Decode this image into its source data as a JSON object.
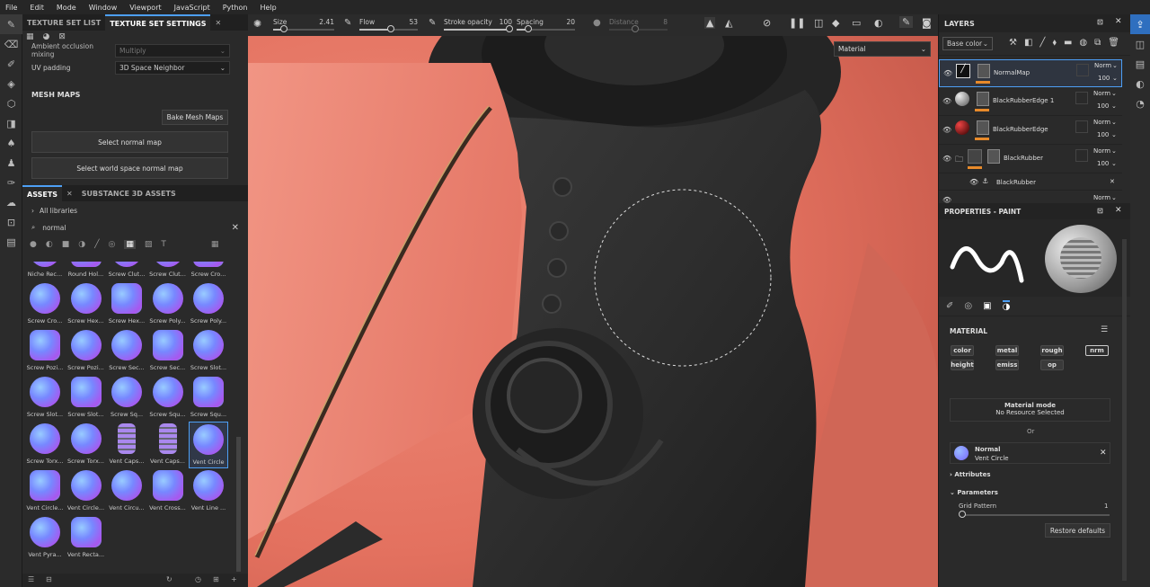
{
  "menu": [
    "File",
    "Edit",
    "Mode",
    "Window",
    "Viewport",
    "JavaScript",
    "Python",
    "Help"
  ],
  "left_panel": {
    "tabs": [
      "TEXTURE SET LIST",
      "TEXTURE SET SETTINGS"
    ],
    "ao_mixing_label": "Ambient occlusion mixing",
    "ao_mixing_value": "Multiply",
    "uv_padding_label": "UV padding",
    "uv_padding_value": "3D Space Neighbor",
    "mesh_maps_title": "MESH MAPS",
    "bake_button": "Bake Mesh Maps",
    "select_normal": "Select normal map",
    "select_world": "Select world space normal map"
  },
  "assets": {
    "tabs": [
      "ASSETS",
      "SUBSTANCE 3D ASSETS"
    ],
    "all_libraries": "All libraries",
    "search_value": "normal",
    "items": [
      {
        "label": "Niche Rec..."
      },
      {
        "label": "Round Hol..."
      },
      {
        "label": "Screw Clut..."
      },
      {
        "label": "Screw Clut..."
      },
      {
        "label": "Screw Cro..."
      },
      {
        "label": "Screw Cro..."
      },
      {
        "label": "Screw Hex..."
      },
      {
        "label": "Screw Hex..."
      },
      {
        "label": "Screw Poly..."
      },
      {
        "label": "Screw Poly..."
      },
      {
        "label": "Screw Pozi..."
      },
      {
        "label": "Screw Pozi..."
      },
      {
        "label": "Screw Sec..."
      },
      {
        "label": "Screw Sec..."
      },
      {
        "label": "Screw Slot..."
      },
      {
        "label": "Screw Slot..."
      },
      {
        "label": "Screw Slot..."
      },
      {
        "label": "Screw Sq..."
      },
      {
        "label": "Screw Squ..."
      },
      {
        "label": "Screw Squ..."
      },
      {
        "label": "Screw Torx..."
      },
      {
        "label": "Screw Torx..."
      },
      {
        "label": "Vent Caps..."
      },
      {
        "label": "Vent Caps..."
      },
      {
        "label": "Vent Circle"
      },
      {
        "label": "Vent Circle..."
      },
      {
        "label": "Vent Circle..."
      },
      {
        "label": "Vent Circu..."
      },
      {
        "label": "Vent Cross..."
      },
      {
        "label": "Vent Line ..."
      },
      {
        "label": "Vent Pyra..."
      },
      {
        "label": "Vent Recta..."
      }
    ]
  },
  "toolbar": {
    "size_label": "Size",
    "size_value": "2.41",
    "flow_label": "Flow",
    "flow_value": "53",
    "stroke_label": "Stroke opacity",
    "stroke_value": "100",
    "spacing_label": "Spacing",
    "spacing_value": "20",
    "distance_label": "Distance",
    "distance_value": "8"
  },
  "viewport": {
    "material_dropdown": "Material"
  },
  "layers": {
    "title": "LAYERS",
    "channel": "Base color",
    "items": [
      {
        "name": "NormalMap",
        "blend": "Norm",
        "opacity": "100"
      },
      {
        "name": "BlackRubberEdge 1",
        "blend": "Norm",
        "opacity": "100"
      },
      {
        "name": "BlackRubberEdge",
        "blend": "Norm",
        "opacity": "100"
      },
      {
        "name": "BlackRubber",
        "blend": "Norm",
        "opacity": "100"
      }
    ],
    "sub_item": "BlackRubber",
    "partial_blend": "Norm"
  },
  "properties": {
    "title": "PROPERTIES - PAINT",
    "material_title": "MATERIAL",
    "channels": [
      "color",
      "metal",
      "rough",
      "nrm",
      "height",
      "emiss",
      "op"
    ],
    "material_mode_label": "Material mode",
    "material_mode_value": "No Resource Selected",
    "or": "Or",
    "normal_label": "Normal",
    "normal_value": "Vent Circle",
    "attributes": "Attributes",
    "parameters": "Parameters",
    "grid_label": "Grid Pattern",
    "grid_value": "1",
    "restore": "Restore defaults"
  }
}
